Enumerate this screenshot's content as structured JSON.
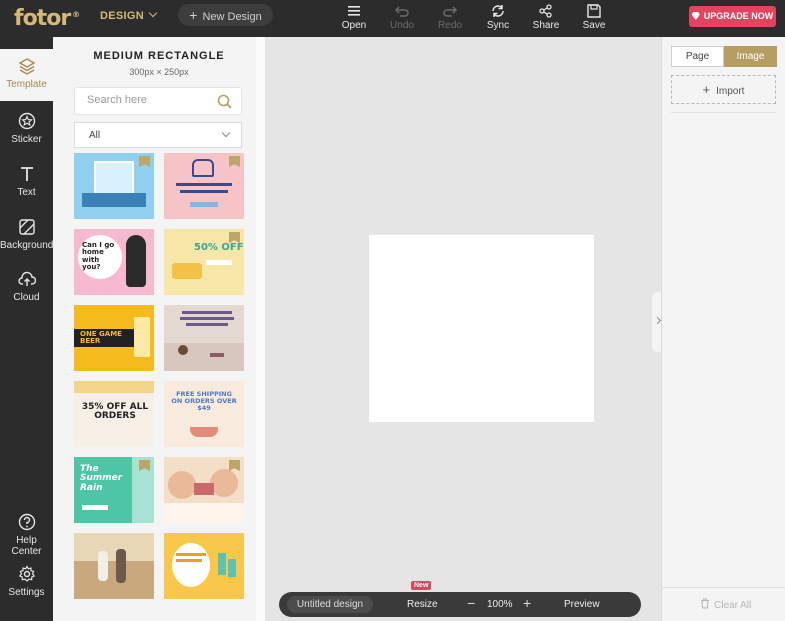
{
  "app": {
    "logo": "fotor",
    "logo_mark": "®",
    "mode_dropdown": "DESIGN",
    "new_design": "New Design",
    "upgrade": "UPGRADE NOW"
  },
  "toolbar": {
    "open": "Open",
    "undo": "Undo",
    "redo": "Redo",
    "sync": "Sync",
    "share": "Share",
    "save": "Save"
  },
  "sidebar": {
    "items": [
      {
        "label": "Template",
        "icon": "layers-icon",
        "active": true
      },
      {
        "label": "Sticker",
        "icon": "star-icon"
      },
      {
        "label": "Text",
        "icon": "text-icon"
      },
      {
        "label": "Background",
        "icon": "background-icon"
      },
      {
        "label": "Cloud",
        "icon": "cloud-upload-icon"
      }
    ],
    "bottom": [
      {
        "label": "Help Center",
        "icon": "help-icon"
      },
      {
        "label": "Settings",
        "icon": "gear-icon"
      }
    ]
  },
  "panel": {
    "title": "MEDIUM RECTANGLE",
    "subtitle": "300px × 250px",
    "search_placeholder": "Search here",
    "filter_value": "All",
    "templates": [
      {
        "name": "blue-window",
        "bg": "#8ed0ee",
        "text": "",
        "premium": true
      },
      {
        "name": "family-hands",
        "bg": "#f6c3c6",
        "text": "",
        "premium": true
      },
      {
        "name": "cat-home",
        "bg": "#f6b9d0",
        "text": "Can I go home with you?",
        "premium": false
      },
      {
        "name": "sofa-sale",
        "bg": "#f6e7a8",
        "text": "50% OFF",
        "premium": true
      },
      {
        "name": "one-game-beer",
        "bg": "#f5bb1c",
        "text": "ONE GAME BEER",
        "premium": false
      },
      {
        "name": "mothers-day-must",
        "bg": "#e4d8d2",
        "text": "",
        "premium": false
      },
      {
        "name": "mothers-day-sale",
        "bg": "#f5efe6",
        "text": "35% OFF ALL ORDERS",
        "premium": false
      },
      {
        "name": "free-shipping",
        "bg": "#f8eadc",
        "text": "FREE SHIPPING ON ORDERS OVER $49",
        "premium": false
      },
      {
        "name": "summer-rain",
        "bg": "#4ec5a5",
        "text": "The Summer Rain",
        "premium": true
      },
      {
        "name": "babies",
        "bg": "#f3dfc8",
        "text": "",
        "premium": true
      },
      {
        "name": "couple-beach",
        "bg": "#c7a97d",
        "text": "",
        "premium": false
      },
      {
        "name": "glitter-nail",
        "bg": "#f8c84a",
        "text": "",
        "premium": false
      }
    ]
  },
  "bottom_bar": {
    "doc_name": "Untitled design",
    "resize": "Resize",
    "new_badge": "New",
    "zoom_out": "−",
    "zoom": "100%",
    "zoom_in": "+",
    "preview": "Preview"
  },
  "right_panel": {
    "tab_page": "Page",
    "tab_image": "Image",
    "import": "Import",
    "clear_all": "Clear All"
  },
  "colors": {
    "accent_gold": "#b69e62",
    "upgrade_pink": "#e2435f",
    "dark_chrome": "#2c2c2c"
  }
}
